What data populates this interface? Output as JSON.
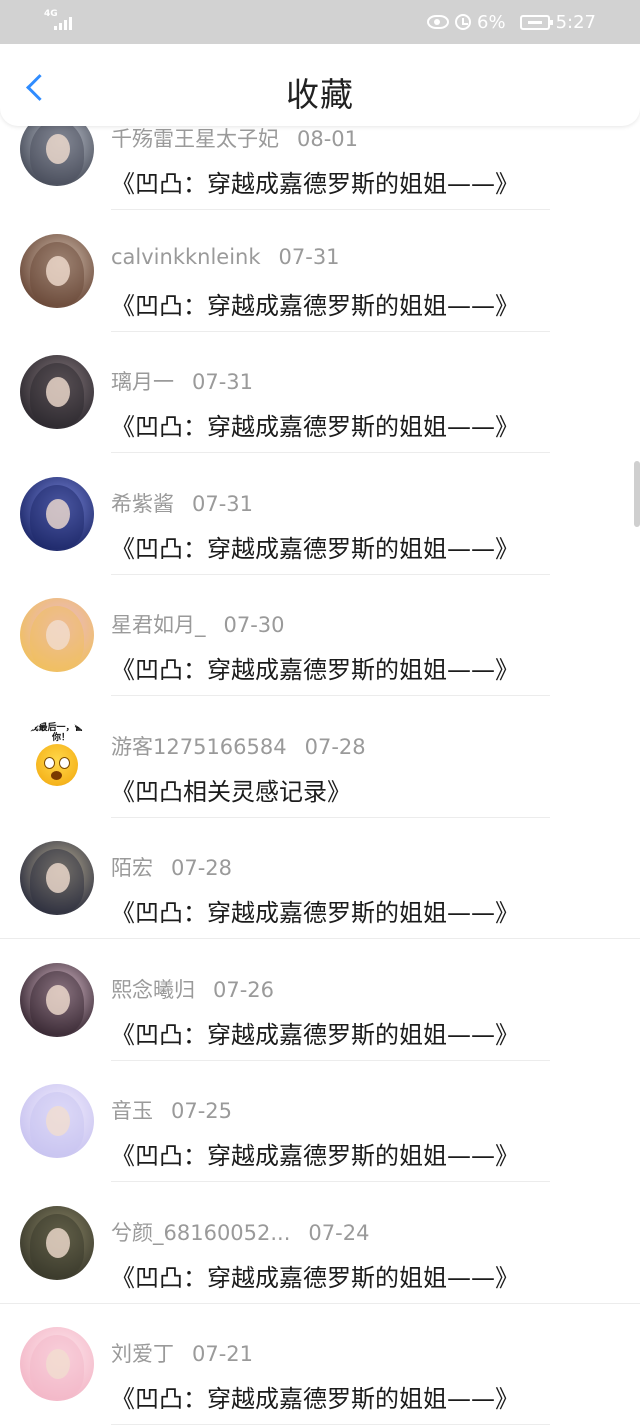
{
  "status_bar": {
    "network": "4G",
    "battery_percent": "6%",
    "time": "5:27",
    "icons": [
      "signal-icon",
      "eye-icon",
      "alarm-icon",
      "battery-icon"
    ]
  },
  "header": {
    "back_icon": "chevron-left-icon",
    "title": "收藏",
    "accent_color": "#2f8cff"
  },
  "items": [
    {
      "user": "千殇雷王星太子妃",
      "date": "08-01",
      "title": "《凹凸：穿越成嘉德罗斯的姐姐——》",
      "avatar_colors": [
        "#4a4f5c",
        "#c7ccd6"
      ]
    },
    {
      "user": "calvinkknleink",
      "date": "07-31",
      "title": "《凹凸：穿越成嘉德罗斯的姐姐——》",
      "avatar_colors": [
        "#6b4a3a",
        "#d9c6b6"
      ]
    },
    {
      "user": "璃月一",
      "date": "07-31",
      "title": "《凹凸：穿越成嘉德罗斯的姐姐——》",
      "avatar_colors": [
        "#2e2a30",
        "#8a7c80"
      ]
    },
    {
      "user": "希紫酱",
      "date": "07-31",
      "title": "《凹凸：穿越成嘉德罗斯的姐姐——》",
      "avatar_colors": [
        "#1f2a6b",
        "#7e8be0"
      ]
    },
    {
      "user": "星君如月_",
      "date": "07-30",
      "title": "《凹凸：穿越成嘉德罗斯的姐姐——》",
      "avatar_colors": [
        "#f0c060",
        "#e9b7d8"
      ]
    },
    {
      "user": "游客1275166584",
      "date": "07-28",
      "title": "《凹凸相关灵感记录》",
      "avatar_caption": "我最后一，警告你！"
    },
    {
      "user": "陌宏",
      "date": "07-28",
      "title": "《凹凸：穿越成嘉德罗斯的姐姐——》",
      "avatar_colors": [
        "#2f3140",
        "#c2b79a"
      ]
    },
    {
      "user": "熙念曦归",
      "date": "07-26",
      "title": "《凹凸：穿越成嘉德罗斯的姐姐——》",
      "avatar_colors": [
        "#3a2a35",
        "#e7c9d8"
      ]
    },
    {
      "user": "音玉",
      "date": "07-25",
      "title": "《凹凸：穿越成嘉德罗斯的姐姐——》",
      "avatar_colors": [
        "#c9c4f0",
        "#f5f0ff"
      ]
    },
    {
      "user": "兮颜_68160052...",
      "date": "07-24",
      "title": "《凹凸：穿越成嘉德罗斯的姐姐——》",
      "avatar_colors": [
        "#3b3a2c",
        "#8f8a6a"
      ]
    },
    {
      "user": "刘爱丁",
      "date": "07-21",
      "title": "《凹凸：穿越成嘉德罗斯的姐姐——》",
      "avatar_colors": [
        "#f3b8c8",
        "#ffe9ef"
      ]
    }
  ]
}
